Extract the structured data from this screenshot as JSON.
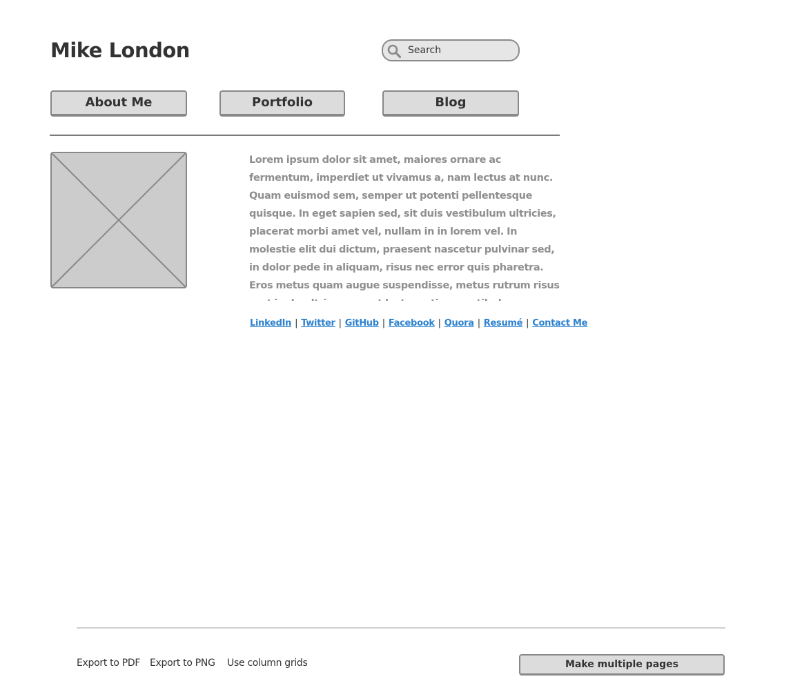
{
  "header": {
    "title": "Mike London"
  },
  "search": {
    "placeholder": "Search"
  },
  "nav": {
    "items": [
      {
        "label": "About Me"
      },
      {
        "label": "Portfolio"
      },
      {
        "label": "Blog"
      }
    ]
  },
  "profile": {
    "image_icon": "image-placeholder-icon"
  },
  "bio": {
    "text": "Lorem ipsum dolor sit amet, maiores ornare ac fermentum, imperdiet ut vivamus a, nam lectus at nunc. Quam euismod sem, semper ut potenti pellentesque quisque. In eget sapien sed, sit duis vestibulum ultricies, placerat morbi amet vel, nullam in in lorem vel. In molestie elit dui dictum, praesent nascetur pulvinar sed, in dolor pede in aliquam, risus nec error quis pharetra. Eros metus quam augue suspendisse, metus rutrum risus erat in.  In ultrices quo ut lectus, etiam vestibulum urna, a est pretium luctus euismod nisl, pellentesque turpis hac ridiculus massa."
  },
  "social": {
    "separator": "|",
    "links": [
      {
        "label": "LinkedIn"
      },
      {
        "label": "Twitter"
      },
      {
        "label": "GitHub"
      },
      {
        "label": "Facebook"
      },
      {
        "label": "Quora"
      },
      {
        "label": "Resumé"
      },
      {
        "label": "Contact Me"
      }
    ]
  },
  "footer": {
    "export_pdf": "Export to PDF",
    "export_png": "Export to PNG",
    "column_grids": "Use column grids",
    "make_pages": "Make multiple pages"
  },
  "colors": {
    "text": "#333333",
    "muted_text": "#8f8f8f",
    "link": "#2d82cf",
    "button_fill": "#dcdcdc",
    "button_border": "#888888",
    "placeholder_fill": "#cccccc"
  },
  "icons": {
    "search": "search-icon"
  }
}
